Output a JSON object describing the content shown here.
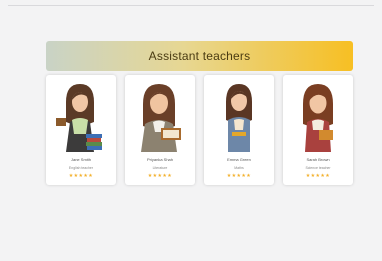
{
  "banner": {
    "title": "Assistant teachers"
  },
  "teachers": [
    {
      "name": "Jane Smith",
      "subtitle": "English teacher",
      "rating": 5,
      "stars": "★★★★★"
    },
    {
      "name": "Priyanka Shah",
      "subtitle": "Literature",
      "rating": 5,
      "stars": "★★★★★"
    },
    {
      "name": "Emma Green",
      "subtitle": "Maths",
      "rating": 5,
      "stars": "★★★★★"
    },
    {
      "name": "Sarah Brown",
      "subtitle": "Science teacher",
      "rating": 5,
      "stars": "★★★★★"
    }
  ]
}
